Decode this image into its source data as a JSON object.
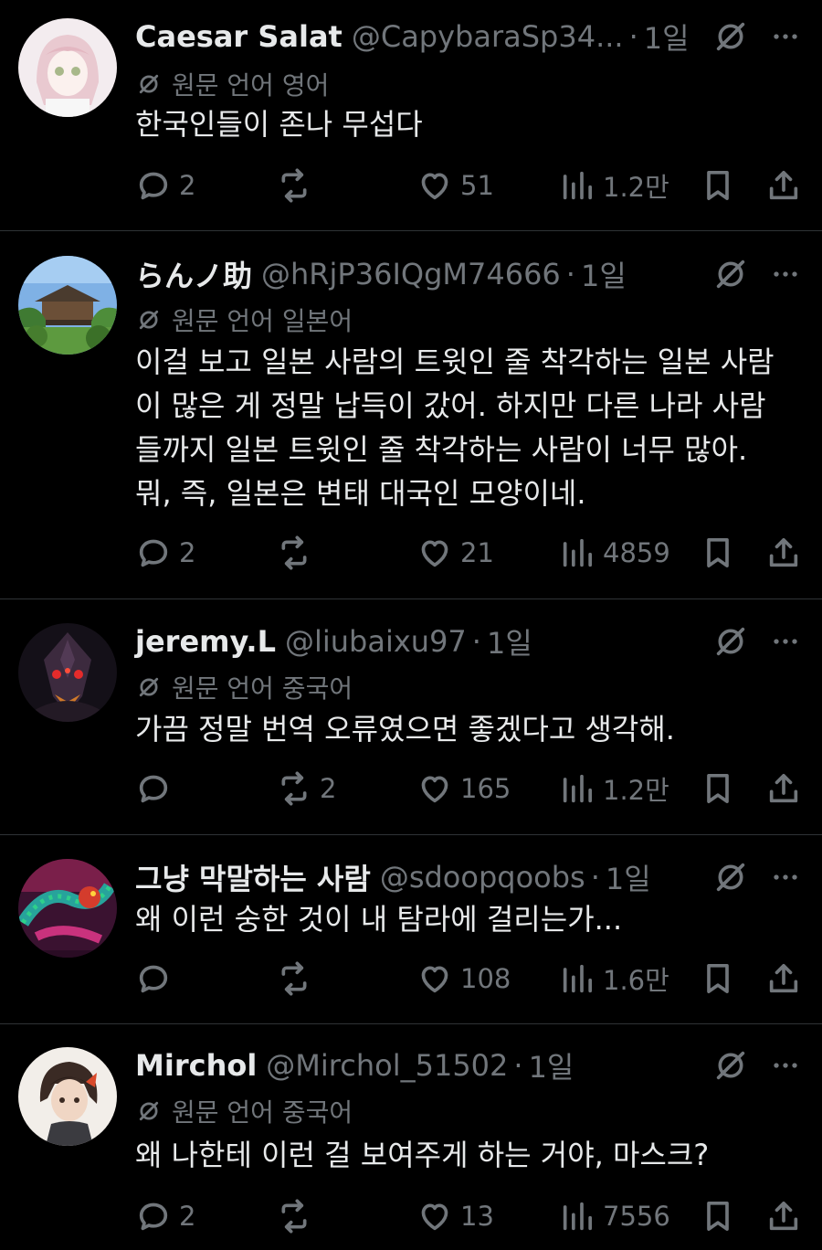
{
  "tweets": [
    {
      "name": "Caesar Salat",
      "handle": "@CapybaraSp34...",
      "dot": "·",
      "time": "1일",
      "translated": "원문 언어 영어",
      "text": [
        "한국인들이 존나 무섭다"
      ],
      "replies": "2",
      "retweets": "",
      "likes": "51",
      "views": "1.2만",
      "avatar": "anime-girl-avatar"
    },
    {
      "name": "らんノ助",
      "handle": "@hRjP36IQgM74666",
      "dot": "·",
      "time": "1일",
      "translated": "원문 언어 일본어",
      "text": [
        "이걸 보고 일본 사람의 트윗인 줄 착각하는 일본 사람",
        "이 많은 게 정말 납득이 갔어. 하지만 다른 나라 사람",
        "들까지 일본 트윗인 줄 착각하는 사람이 너무 많아.",
        "뭐, 즉, 일본은 변태 대국인 모양이네."
      ],
      "replies": "2",
      "retweets": "",
      "likes": "21",
      "views": "4859",
      "avatar": "temple-avatar"
    },
    {
      "name": "jeremy.L",
      "handle": "@liubaixu97",
      "dot": "·",
      "time": "1일",
      "translated": "원문 언어 중국어",
      "text": [
        "가끔 정말 번역 오류였으면 좋겠다고 생각해."
      ],
      "replies": "",
      "retweets": "2",
      "likes": "165",
      "views": "1.2만",
      "avatar": "robot-avatar"
    },
    {
      "name": "그냥 막말하는 사람",
      "handle": "@sdoopqoobs",
      "dot": "·",
      "time": "1일",
      "translated": "",
      "text": [
        "왜 이런 숭한 것이 내 탐라에 걸리는가..."
      ],
      "replies": "",
      "retweets": "",
      "likes": "108",
      "views": "1.6만",
      "avatar": "dragon-avatar"
    },
    {
      "name": "Mirchol",
      "handle": "@Mirchol_51502",
      "dot": "·",
      "time": "1일",
      "translated": "원문 언어 중국어",
      "text": [
        "왜 나한테 이런 걸 보여주게 하는 거야, 마스크?"
      ],
      "replies": "2",
      "retweets": "",
      "likes": "13",
      "views": "7556",
      "avatar": "anime-boy-avatar"
    }
  ],
  "colors": {
    "background": "#000000",
    "text": "#e7e9ea",
    "muted": "#71767b",
    "divider": "#2f3336"
  }
}
